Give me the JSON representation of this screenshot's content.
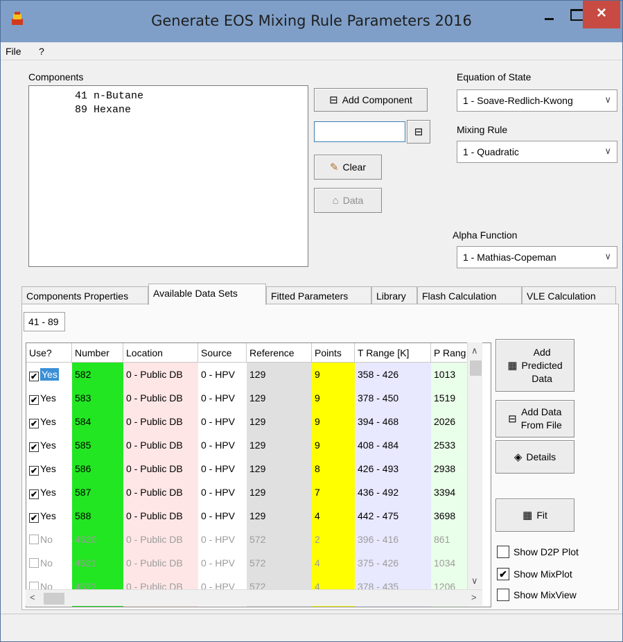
{
  "window": {
    "title": "Generate EOS Mixing Rule Parameters 2016",
    "close_glyph": "✕"
  },
  "menu": {
    "file": "File",
    "help": "?"
  },
  "components": {
    "label": "Components",
    "items": [
      {
        "id": "41",
        "name": "n-Butane"
      },
      {
        "id": "89",
        "name": "Hexane"
      }
    ],
    "add_button": "Add Component",
    "input_value": "",
    "clear_button": "Clear",
    "data_button": "Data"
  },
  "eos": {
    "label": "Equation of State",
    "value": "1 - Soave-Redlich-Kwong",
    "mixing_label": "Mixing Rule",
    "mixing_value": "1 - Quadratic",
    "alpha_label": "Alpha Function",
    "alpha_value": "1 - Mathias-Copeman"
  },
  "tabs": [
    "Components Properties",
    "Available Data Sets",
    "Fitted Parameters",
    "Library",
    "Flash Calculation",
    "VLE Calculation"
  ],
  "subtab": "41 - 89",
  "grid": {
    "headers": [
      "Use?",
      "Number",
      "Location",
      "Source",
      "Reference",
      "Points",
      "T Range [K]",
      "P Rang"
    ],
    "rows": [
      {
        "use": "Yes",
        "checked": "✔",
        "number": "582",
        "location": "0 - Public DB",
        "source": "0 - HPV",
        "reference": "129",
        "points": "9",
        "trange": "358 - 426",
        "prange": "1013"
      },
      {
        "use": "Yes",
        "checked": "✔",
        "number": "583",
        "location": "0 - Public DB",
        "source": "0 - HPV",
        "reference": "129",
        "points": "9",
        "trange": "378 - 450",
        "prange": "1519"
      },
      {
        "use": "Yes",
        "checked": "✔",
        "number": "584",
        "location": "0 - Public DB",
        "source": "0 - HPV",
        "reference": "129",
        "points": "9",
        "trange": "394 - 468",
        "prange": "2026"
      },
      {
        "use": "Yes",
        "checked": "✔",
        "number": "585",
        "location": "0 - Public DB",
        "source": "0 - HPV",
        "reference": "129",
        "points": "9",
        "trange": "408 - 484",
        "prange": "2533"
      },
      {
        "use": "Yes",
        "checked": "✔",
        "number": "586",
        "location": "0 - Public DB",
        "source": "0 - HPV",
        "reference": "129",
        "points": "8",
        "trange": "426 - 493",
        "prange": "2938"
      },
      {
        "use": "Yes",
        "checked": "✔",
        "number": "587",
        "location": "0 - Public DB",
        "source": "0 - HPV",
        "reference": "129",
        "points": "7",
        "trange": "436 - 492",
        "prange": "3394"
      },
      {
        "use": "Yes",
        "checked": "✔",
        "number": "588",
        "location": "0 - Public DB",
        "source": "0 - HPV",
        "reference": "129",
        "points": "4",
        "trange": "442 - 475",
        "prange": "3698"
      },
      {
        "use": "No",
        "checked": "",
        "number": "4520",
        "location": "0 - Public DB",
        "source": "0 - HPV",
        "reference": "572",
        "points": "2",
        "trange": "396 - 416",
        "prange": "861"
      },
      {
        "use": "No",
        "checked": "",
        "number": "4521",
        "location": "0 - Public DB",
        "source": "0 - HPV",
        "reference": "572",
        "points": "4",
        "trange": "375 - 426",
        "prange": "1034"
      },
      {
        "use": "No",
        "checked": "",
        "number": "4522",
        "location": "0 - Public DB",
        "source": "0 - HPV",
        "reference": "572",
        "points": "4",
        "trange": "378 - 435",
        "prange": "1206"
      }
    ]
  },
  "side": {
    "add_predicted": [
      "Add",
      "Predicted",
      "Data"
    ],
    "add_from_file": [
      "Add Data",
      "From File"
    ],
    "details": "Details",
    "fit": "Fit",
    "show_d2p": "Show D2P Plot",
    "show_mixplot": "Show MixPlot",
    "show_mixview": "Show MixView",
    "mixplot_check": "✔"
  },
  "colors": {
    "number_col": "#22e622",
    "location_col": "#ffe6e6",
    "reference_col": "#e0e0e0",
    "points_col": "#ffff00",
    "trange_col": "#e8e8ff",
    "prange_col": "#eaffea"
  }
}
